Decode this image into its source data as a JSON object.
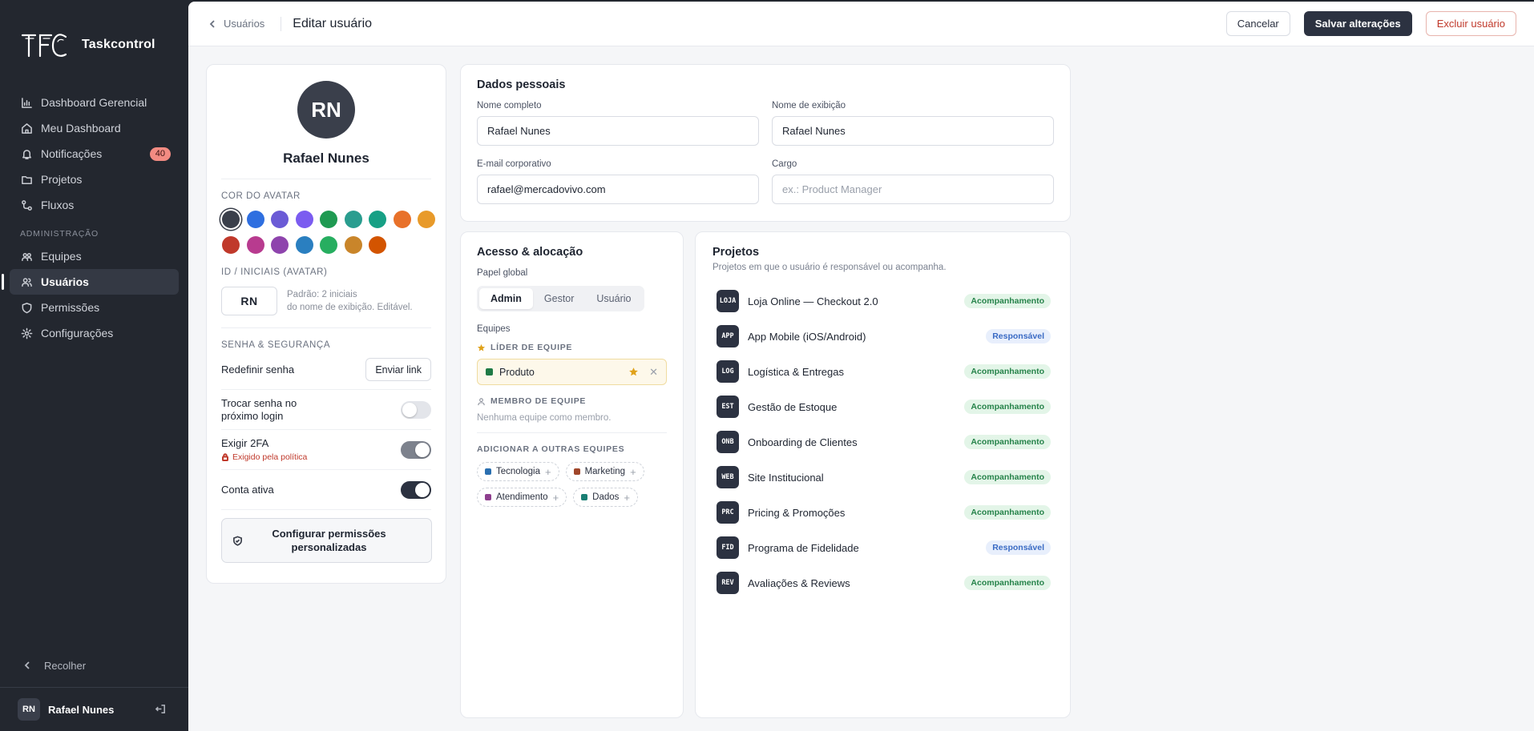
{
  "brand": {
    "name": "Taskcontrol"
  },
  "sidebar": {
    "items": [
      {
        "label": "Dashboard Gerencial",
        "icon": "chart-icon"
      },
      {
        "label": "Meu Dashboard",
        "icon": "home-icon"
      },
      {
        "label": "Notificações",
        "icon": "bell-icon",
        "badge": "40"
      },
      {
        "label": "Projetos",
        "icon": "folder-icon"
      },
      {
        "label": "Fluxos",
        "icon": "flow-icon"
      }
    ],
    "section_admin": "ADMINISTRAÇÃO",
    "admin_items": [
      {
        "label": "Equipes",
        "icon": "team-icon"
      },
      {
        "label": "Usuários",
        "icon": "users-icon",
        "active": true
      },
      {
        "label": "Permissões",
        "icon": "shield-icon"
      },
      {
        "label": "Configurações",
        "icon": "gear-icon"
      }
    ],
    "collapse_label": "Recolher",
    "user": {
      "initials": "RN",
      "name": "Rafael Nunes"
    }
  },
  "topbar": {
    "breadcrumb": "Usuários",
    "title": "Editar usuário",
    "cancel": "Cancelar",
    "save": "Salvar alterações",
    "delete": "Excluir usuário"
  },
  "profile": {
    "initials": "RN",
    "name": "Rafael Nunes",
    "avatar_color_label": "COR DO AVATAR",
    "swatches": [
      "#3a3f4b",
      "#2f6fe0",
      "#6b5bd6",
      "#7b5cf0",
      "#1f9a52",
      "#2a9d8f",
      "#17a085",
      "#e8712a",
      "#e89a2a",
      "#c0392b",
      "#b83b8f",
      "#8e44ad",
      "#2a7fc0",
      "#27ae60",
      "#c9852a",
      "#d35400"
    ],
    "initials_label": "ID / INICIAIS (AVATAR)",
    "initials_value": "RN",
    "initials_hint_1": "Padrão: 2 iniciais",
    "initials_hint_2": "do nome de exibição. Editável.",
    "security_label": "SENHA & SEGURANÇA",
    "reset_password": "Redefinir senha",
    "send_link": "Enviar link",
    "change_pw_1": "Trocar senha no",
    "change_pw_2": "próximo login",
    "require_2fa": "Exigir 2FA",
    "policy_note": "Exigido pela política",
    "active_account": "Conta ativa",
    "perm_btn_1": "Configurar permissões",
    "perm_btn_2": "personalizadas"
  },
  "personal": {
    "title": "Dados pessoais",
    "full_name_label": "Nome completo",
    "full_name": "Rafael Nunes",
    "display_name_label": "Nome de exibição",
    "display_name": "Rafael Nunes",
    "email_label": "E-mail corporativo",
    "email": "rafael@mercadovivo.com",
    "role_label": "Cargo",
    "role_placeholder": "ex.: Product Manager"
  },
  "access": {
    "title": "Acesso & alocação",
    "global_role_label": "Papel global",
    "roles": [
      "Admin",
      "Gestor",
      "Usuário"
    ],
    "teams_label": "Equipes",
    "leader_label": "LÍDER DE EQUIPE",
    "leader_team": {
      "name": "Produto",
      "color": "#1f7a45"
    },
    "member_label": "MEMBRO DE EQUIPE",
    "member_empty": "Nenhuma equipe como membro.",
    "add_label": "ADICIONAR A OUTRAS EQUIPES",
    "add_teams": [
      {
        "name": "Tecnologia",
        "color": "#2a6fb0"
      },
      {
        "name": "Marketing",
        "color": "#a0462a"
      },
      {
        "name": "Atendimento",
        "color": "#8e3f8e"
      },
      {
        "name": "Dados",
        "color": "#1a7f74"
      }
    ]
  },
  "projects": {
    "title": "Projetos",
    "subtitle": "Projetos em que o usuário é responsável ou acompanha.",
    "items": [
      {
        "code": "LOJA",
        "name": "Loja Online — Checkout 2.0",
        "status": "Acompanhamento",
        "kind": "acomp"
      },
      {
        "code": "APP",
        "name": "App Mobile (iOS/Android)",
        "status": "Responsável",
        "kind": "resp"
      },
      {
        "code": "LOG",
        "name": "Logística & Entregas",
        "status": "Acompanhamento",
        "kind": "acomp"
      },
      {
        "code": "EST",
        "name": "Gestão de Estoque",
        "status": "Acompanhamento",
        "kind": "acomp"
      },
      {
        "code": "ONB",
        "name": "Onboarding de Clientes",
        "status": "Acompanhamento",
        "kind": "acomp"
      },
      {
        "code": "WEB",
        "name": "Site Institucional",
        "status": "Acompanhamento",
        "kind": "acomp"
      },
      {
        "code": "PRC",
        "name": "Pricing & Promoções",
        "status": "Acompanhamento",
        "kind": "acomp"
      },
      {
        "code": "FID",
        "name": "Programa de Fidelidade",
        "status": "Responsável",
        "kind": "resp"
      },
      {
        "code": "REV",
        "name": "Avaliações & Reviews",
        "status": "Acompanhamento",
        "kind": "acomp"
      }
    ]
  }
}
